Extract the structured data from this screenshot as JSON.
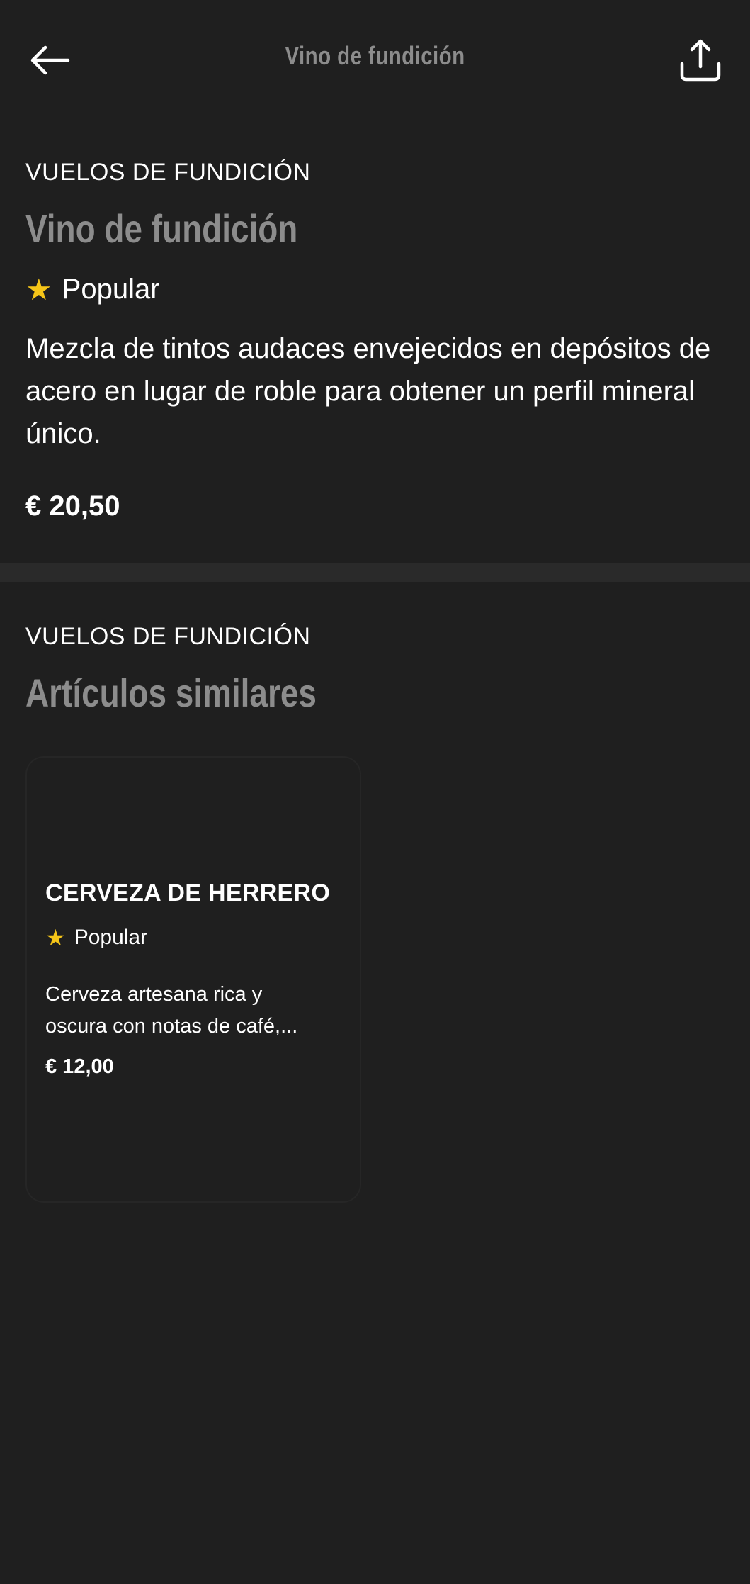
{
  "topbar": {
    "title": "Vino de fundición",
    "back_icon": "arrow-left-icon",
    "share_icon": "share-icon"
  },
  "item": {
    "category": "VUELOS DE FUNDICIÓN",
    "name": "Vino de fundición",
    "badge": "Popular",
    "badge_icon": "star-icon",
    "description": "Mezcla de tintos audaces envejecidos en depósitos de acero en lugar de roble para obtener un perfil mineral único.",
    "price": "€ 20,50"
  },
  "similar": {
    "category": "VUELOS DE FUNDICIÓN",
    "heading": "Artículos similares",
    "items": [
      {
        "name": "CERVEZA DE HERRERO",
        "badge": "Popular",
        "description_line1": "Cerveza artesana rica y",
        "description_line2": "oscura con notas de café,...",
        "price": "€ 12,00"
      }
    ]
  },
  "colors": {
    "background": "#1f1f1f",
    "divider": "#2a2a2a",
    "muted_heading": "#8c8c8c",
    "star": "#f5c518",
    "text": "#ffffff"
  }
}
